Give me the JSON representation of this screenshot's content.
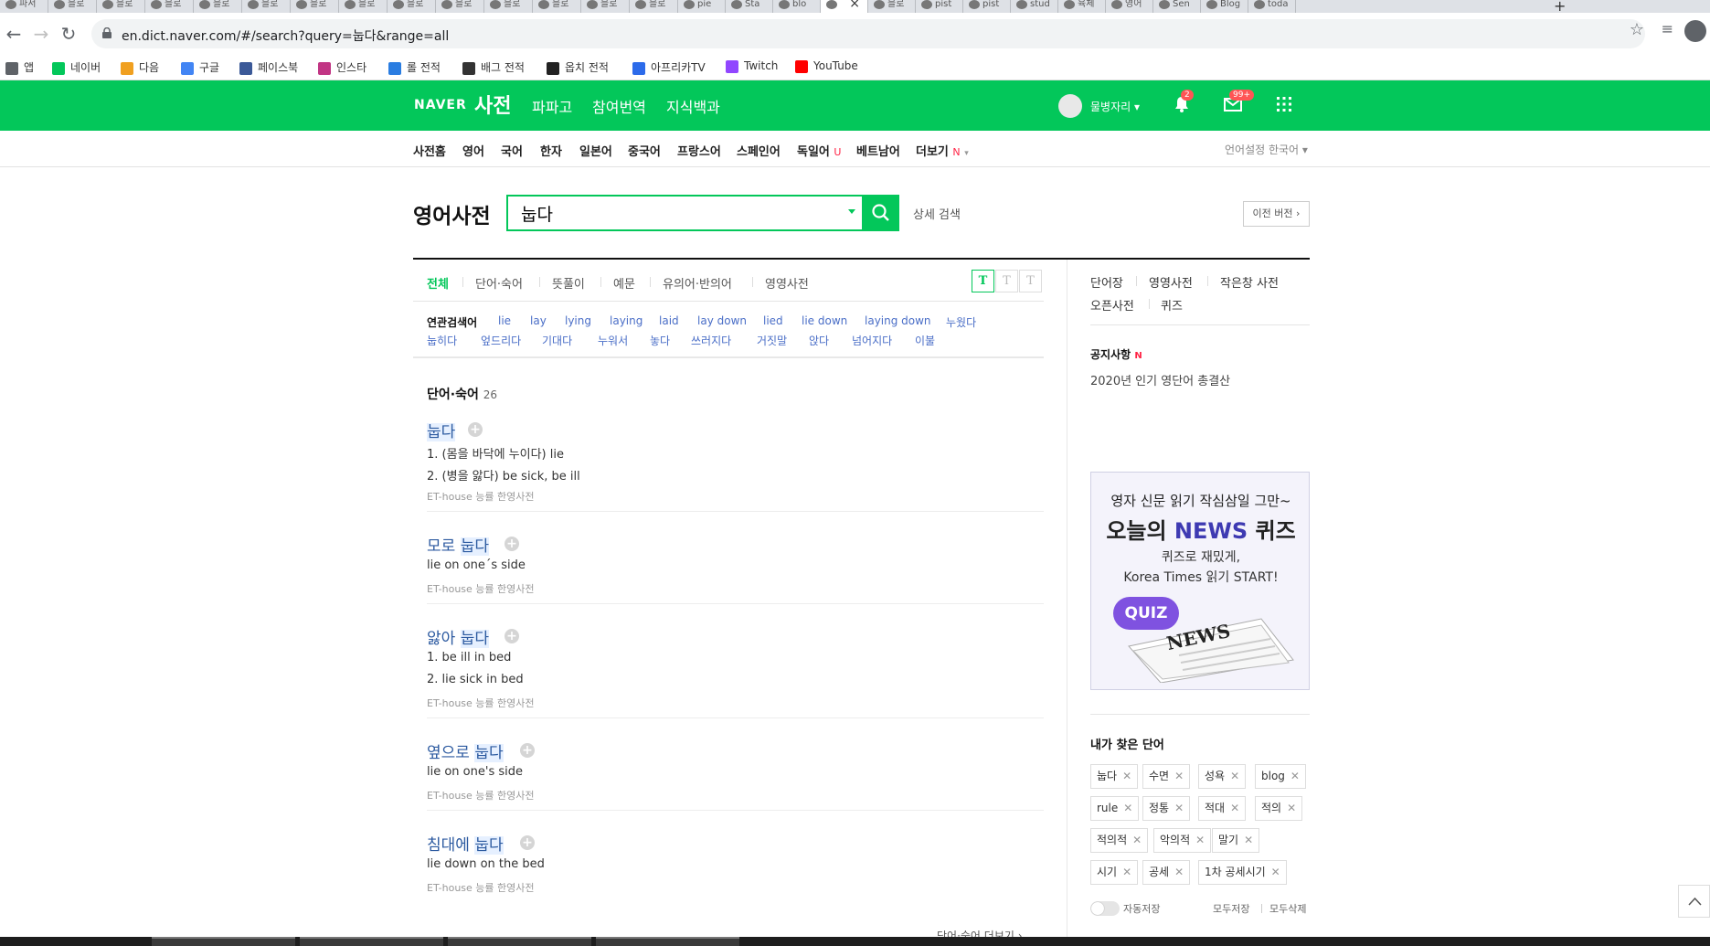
{
  "browser": {
    "tabs": [
      {
        "label": "파서"
      },
      {
        "label": "블로"
      },
      {
        "label": "블로"
      },
      {
        "label": "블로"
      },
      {
        "label": "블로"
      },
      {
        "label": "블로"
      },
      {
        "label": "블로"
      },
      {
        "label": "블로"
      },
      {
        "label": "블로"
      },
      {
        "label": "블로"
      },
      {
        "label": "블로"
      },
      {
        "label": "블로"
      },
      {
        "label": "블로"
      },
      {
        "label": "블로"
      },
      {
        "label": "pie"
      },
      {
        "label": "Sta"
      },
      {
        "label": "blo"
      },
      {
        "label": "",
        "active": true
      },
      {
        "label": "블로"
      },
      {
        "label": "pist"
      },
      {
        "label": "pist"
      },
      {
        "label": "stud"
      },
      {
        "label": "육체"
      },
      {
        "label": "영어"
      },
      {
        "label": "Sen"
      },
      {
        "label": "Blog"
      },
      {
        "label": "toda"
      }
    ],
    "url": "en.dict.naver.com/#/search?query=눕다&range=all",
    "bookmarks": [
      {
        "label": "앱",
        "color": "#5f6368"
      },
      {
        "label": "네이버",
        "color": "#03c75a"
      },
      {
        "label": "다음",
        "color": "#f0a020"
      },
      {
        "label": "구글",
        "color": "#4285f4"
      },
      {
        "label": "페이스북",
        "color": "#3b5998"
      },
      {
        "label": "인스타",
        "color": "#c13584"
      },
      {
        "label": "롤 전적",
        "color": "#2a7de1"
      },
      {
        "label": "배그 전적",
        "color": "#333333"
      },
      {
        "label": "옵치 전적",
        "color": "#222222"
      },
      {
        "label": "아프리카TV",
        "color": "#2c6bea"
      },
      {
        "label": "Twitch",
        "color": "#9146ff"
      },
      {
        "label": "YouTube",
        "color": "#ff0000"
      }
    ]
  },
  "header": {
    "logo": "NAVER",
    "service": "사전",
    "nav": [
      "파파고",
      "참여번역",
      "지식백과"
    ],
    "user_name": "물병자리",
    "bell_badge": "2",
    "mail_badge": "99+",
    "brand_color": "#03c75a"
  },
  "lnb": {
    "items": [
      "사전홈",
      "영어",
      "국어",
      "한자",
      "일본어",
      "중국어",
      "프랑스어",
      "스페인어",
      "독일어",
      "베트남어",
      "더보기"
    ],
    "german_mark": "U",
    "more_mark": "N",
    "language_setting": "언어설정 한국어"
  },
  "search": {
    "title": "영어사전",
    "query": "눕다",
    "detail_label": "상세 검색",
    "prev_version": "이전 버전"
  },
  "filters": {
    "tabs": [
      "전체",
      "단어·숙어",
      "뜻풀이",
      "예문",
      "유의어·반의어",
      "영영사전"
    ],
    "active": "전체",
    "text_size_buttons": [
      "T",
      "T",
      "T"
    ]
  },
  "related": {
    "label": "연관검색어",
    "row1": [
      "lie",
      "lay",
      "lying",
      "laying",
      "laid",
      "lay down",
      "lied",
      "lie down",
      "laying down",
      "누웠다"
    ],
    "row2": [
      "눕히다",
      "엎드리다",
      "기대다",
      "누워서",
      "놓다",
      "쓰러지다",
      "거짓말",
      "앉다",
      "넘어지다",
      "이불"
    ]
  },
  "results": {
    "section_title": "단어·숙어",
    "count": "26",
    "entries": [
      {
        "pre": "",
        "hl": "눕다",
        "lines": [
          "1. (몸을 바닥에 누이다) lie",
          "2. (병을 앓다) be sick, be ill"
        ],
        "source": "ET-house 능률 한영사전"
      },
      {
        "pre": "모로 ",
        "hl": "눕다",
        "lines": [
          "lie on one´s side"
        ],
        "source": "ET-house 능률 한영사전"
      },
      {
        "pre": "앓아 ",
        "hl": "눕다",
        "lines": [
          "1. be ill in bed",
          "2. lie sick in bed"
        ],
        "source": "ET-house 능률 한영사전"
      },
      {
        "pre": "옆으로 ",
        "hl": "눕다",
        "lines": [
          "lie on one's side"
        ],
        "source": "ET-house 능률 한영사전"
      },
      {
        "pre": "침대에 ",
        "hl": "눕다",
        "lines": [
          "lie down on the bed"
        ],
        "source": "ET-house 능률 한영사전"
      }
    ],
    "more_link": "단어·숙어 더보기"
  },
  "sidebar": {
    "links_row1": [
      "단어장",
      "영영사전",
      "작은창 사전"
    ],
    "links_row2": [
      "오픈사전",
      "퀴즈"
    ],
    "notice_title": "공지사항",
    "notice_mark": "N",
    "notice_item": "2020년 인기 영단어 총결산",
    "ad": {
      "line1": "영자 신문 읽기 작심삼일 그만~",
      "line2_pre": "오늘의 ",
      "line2_news": "NEWS",
      "line2_post": " 퀴즈",
      "line3": "퀴즈로 재밌게,",
      "line4": "Korea Times 읽기 START!",
      "quiz_label": "QUIZ",
      "paper_label": "NEWS"
    },
    "recent_title": "내가 찾은 단어",
    "recent_words": [
      [
        "눕다",
        "수면",
        "성욕",
        "blog"
      ],
      [
        "rule",
        "정통",
        "적대",
        "적의"
      ],
      [
        "적의적",
        "악의적",
        "말기"
      ],
      [
        "시기",
        "공세",
        "1차 공세시기"
      ]
    ],
    "auto_save": "자동저장",
    "save_all": "모두저장",
    "delete_all": "모두삭제"
  }
}
